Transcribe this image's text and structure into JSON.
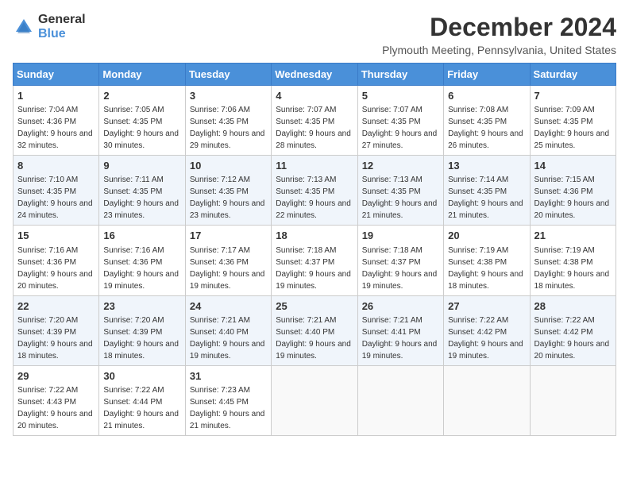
{
  "logo": {
    "general": "General",
    "blue": "Blue"
  },
  "title": "December 2024",
  "location": "Plymouth Meeting, Pennsylvania, United States",
  "headers": [
    "Sunday",
    "Monday",
    "Tuesday",
    "Wednesday",
    "Thursday",
    "Friday",
    "Saturday"
  ],
  "weeks": [
    [
      {
        "day": "1",
        "sunrise": "7:04 AM",
        "sunset": "4:36 PM",
        "daylight": "9 hours and 32 minutes."
      },
      {
        "day": "2",
        "sunrise": "7:05 AM",
        "sunset": "4:35 PM",
        "daylight": "9 hours and 30 minutes."
      },
      {
        "day": "3",
        "sunrise": "7:06 AM",
        "sunset": "4:35 PM",
        "daylight": "9 hours and 29 minutes."
      },
      {
        "day": "4",
        "sunrise": "7:07 AM",
        "sunset": "4:35 PM",
        "daylight": "9 hours and 28 minutes."
      },
      {
        "day": "5",
        "sunrise": "7:07 AM",
        "sunset": "4:35 PM",
        "daylight": "9 hours and 27 minutes."
      },
      {
        "day": "6",
        "sunrise": "7:08 AM",
        "sunset": "4:35 PM",
        "daylight": "9 hours and 26 minutes."
      },
      {
        "day": "7",
        "sunrise": "7:09 AM",
        "sunset": "4:35 PM",
        "daylight": "9 hours and 25 minutes."
      }
    ],
    [
      {
        "day": "8",
        "sunrise": "7:10 AM",
        "sunset": "4:35 PM",
        "daylight": "9 hours and 24 minutes."
      },
      {
        "day": "9",
        "sunrise": "7:11 AM",
        "sunset": "4:35 PM",
        "daylight": "9 hours and 23 minutes."
      },
      {
        "day": "10",
        "sunrise": "7:12 AM",
        "sunset": "4:35 PM",
        "daylight": "9 hours and 23 minutes."
      },
      {
        "day": "11",
        "sunrise": "7:13 AM",
        "sunset": "4:35 PM",
        "daylight": "9 hours and 22 minutes."
      },
      {
        "day": "12",
        "sunrise": "7:13 AM",
        "sunset": "4:35 PM",
        "daylight": "9 hours and 21 minutes."
      },
      {
        "day": "13",
        "sunrise": "7:14 AM",
        "sunset": "4:35 PM",
        "daylight": "9 hours and 21 minutes."
      },
      {
        "day": "14",
        "sunrise": "7:15 AM",
        "sunset": "4:36 PM",
        "daylight": "9 hours and 20 minutes."
      }
    ],
    [
      {
        "day": "15",
        "sunrise": "7:16 AM",
        "sunset": "4:36 PM",
        "daylight": "9 hours and 20 minutes."
      },
      {
        "day": "16",
        "sunrise": "7:16 AM",
        "sunset": "4:36 PM",
        "daylight": "9 hours and 19 minutes."
      },
      {
        "day": "17",
        "sunrise": "7:17 AM",
        "sunset": "4:36 PM",
        "daylight": "9 hours and 19 minutes."
      },
      {
        "day": "18",
        "sunrise": "7:18 AM",
        "sunset": "4:37 PM",
        "daylight": "9 hours and 19 minutes."
      },
      {
        "day": "19",
        "sunrise": "7:18 AM",
        "sunset": "4:37 PM",
        "daylight": "9 hours and 19 minutes."
      },
      {
        "day": "20",
        "sunrise": "7:19 AM",
        "sunset": "4:38 PM",
        "daylight": "9 hours and 18 minutes."
      },
      {
        "day": "21",
        "sunrise": "7:19 AM",
        "sunset": "4:38 PM",
        "daylight": "9 hours and 18 minutes."
      }
    ],
    [
      {
        "day": "22",
        "sunrise": "7:20 AM",
        "sunset": "4:39 PM",
        "daylight": "9 hours and 18 minutes."
      },
      {
        "day": "23",
        "sunrise": "7:20 AM",
        "sunset": "4:39 PM",
        "daylight": "9 hours and 18 minutes."
      },
      {
        "day": "24",
        "sunrise": "7:21 AM",
        "sunset": "4:40 PM",
        "daylight": "9 hours and 19 minutes."
      },
      {
        "day": "25",
        "sunrise": "7:21 AM",
        "sunset": "4:40 PM",
        "daylight": "9 hours and 19 minutes."
      },
      {
        "day": "26",
        "sunrise": "7:21 AM",
        "sunset": "4:41 PM",
        "daylight": "9 hours and 19 minutes."
      },
      {
        "day": "27",
        "sunrise": "7:22 AM",
        "sunset": "4:42 PM",
        "daylight": "9 hours and 19 minutes."
      },
      {
        "day": "28",
        "sunrise": "7:22 AM",
        "sunset": "4:42 PM",
        "daylight": "9 hours and 20 minutes."
      }
    ],
    [
      {
        "day": "29",
        "sunrise": "7:22 AM",
        "sunset": "4:43 PM",
        "daylight": "9 hours and 20 minutes."
      },
      {
        "day": "30",
        "sunrise": "7:22 AM",
        "sunset": "4:44 PM",
        "daylight": "9 hours and 21 minutes."
      },
      {
        "day": "31",
        "sunrise": "7:23 AM",
        "sunset": "4:45 PM",
        "daylight": "9 hours and 21 minutes."
      },
      null,
      null,
      null,
      null
    ]
  ]
}
